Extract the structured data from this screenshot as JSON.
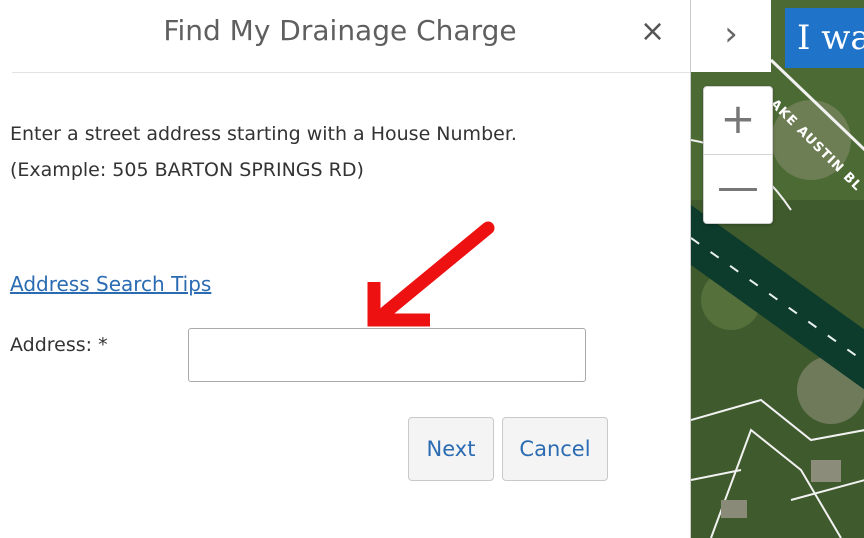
{
  "panel": {
    "title": "Find My Drainage Charge",
    "close_icon": "×",
    "instructions": [
      "Enter a street address starting with a House Number.",
      "(Example: 505 BARTON SPRINGS RD)"
    ],
    "tips_link": "Address Search Tips",
    "address_label": "Address: *",
    "address_value": "",
    "next_label": "Next",
    "cancel_label": "Cancel"
  },
  "map": {
    "collapse_icon": "›",
    "zoom_in": "+",
    "zoom_out": "—",
    "banner_text": "I wa",
    "road_label": "LAKE AUSTIN BL"
  },
  "colors": {
    "link": "#2a6bb2",
    "banner": "#1f73c9",
    "annotation_arrow": "#ee1111",
    "river": "#0d3b2c"
  },
  "icons": [
    "close-icon",
    "chevron-right-icon",
    "plus-icon",
    "minus-icon",
    "red-arrow-annotation"
  ]
}
